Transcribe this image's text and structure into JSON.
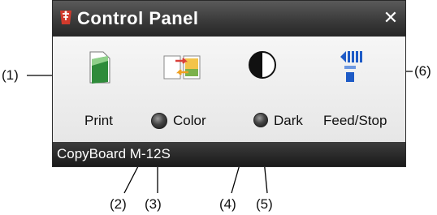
{
  "window": {
    "title": "Control Panel",
    "close_symbol": "✕",
    "status": "CopyBoard M-12S"
  },
  "buttons": {
    "print": {
      "label": "Print",
      "icon": "print-document-icon"
    },
    "color": {
      "label": "Color",
      "icon": "color-swap-icon"
    },
    "dark": {
      "label": "Dark",
      "icon": "contrast-icon"
    },
    "feed_stop": {
      "label": "Feed/Stop",
      "icon": "feed-stop-icon"
    }
  },
  "indicators": {
    "color_led": "indicator-led",
    "dark_led": "indicator-led"
  },
  "callouts": {
    "c1": "(1)",
    "c2": "(2)",
    "c3": "(3)",
    "c4": "(4)",
    "c5": "(5)",
    "c6": "(6)"
  },
  "colors": {
    "title_bar": "#3b3b3b",
    "panel_bg": "#f2f2f2",
    "feed_icon": "#1e5bc6",
    "print_icon": "#2e8b3a",
    "color_icon_red": "#d9413b",
    "color_icon_orange": "#f0a020"
  }
}
